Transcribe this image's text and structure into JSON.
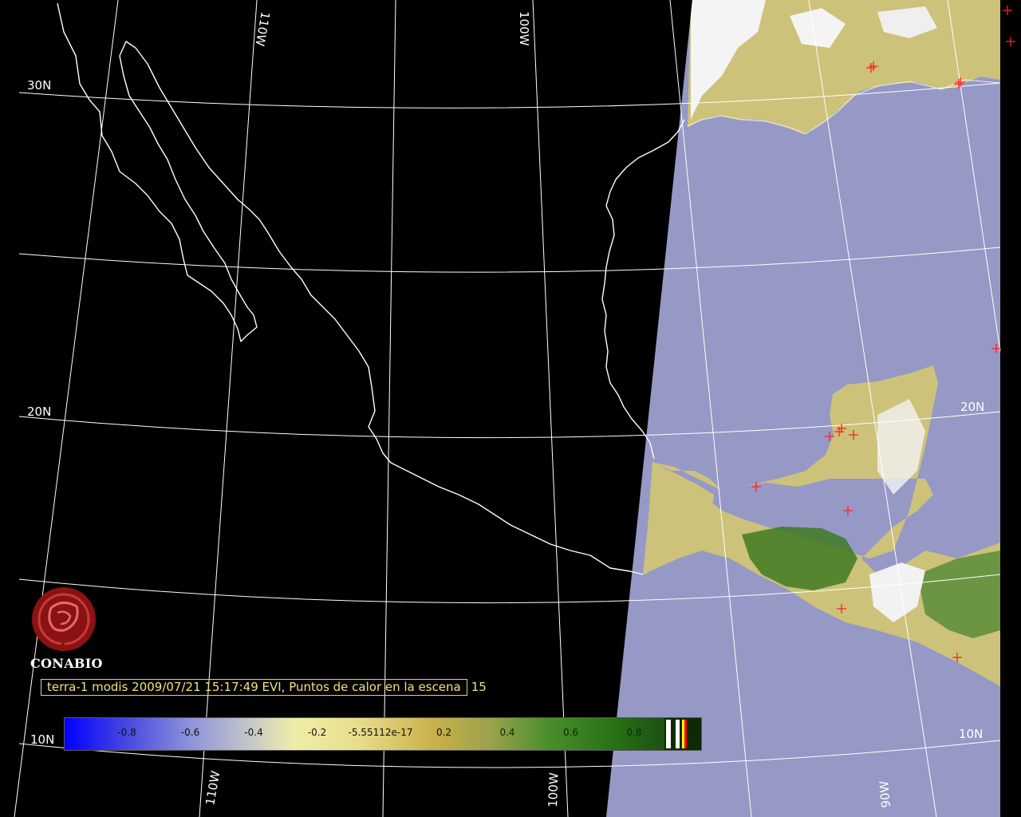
{
  "map": {
    "colors": {
      "background": "#000000",
      "ocean": "#9699c6",
      "land": "#cdc27a",
      "vegetation": "#3f7a22",
      "cloud": "#f4f4f4",
      "grid": "#ffffff",
      "coastline": "#ffffff",
      "hotspot": "#ff2020"
    },
    "grid_labels": {
      "lat_30n_left": "30N",
      "lat_20n_left": "20N",
      "lat_20n_right": "20N",
      "lat_10n_left": "10N",
      "lat_10n_right": "10N",
      "lon_110w_top": "110W",
      "lon_100w_top": "100W",
      "lon_110w_bottom": "110W",
      "lon_100w_bottom": "100W",
      "lon_90w_bottom": "90W"
    },
    "hotspot_count": 15
  },
  "logo": {
    "name": "CONABIO",
    "icon": "conabio-logo-icon"
  },
  "caption": {
    "text": "terra-1 modis 2009/07/21 15:17:49 EVI, Puntos de calor en la escena",
    "count": "15"
  },
  "colorbar": {
    "ticks": [
      "-0.8",
      "-0.6",
      "-0.4",
      "-0.2",
      "-5.55112e-17",
      "0.2",
      "0.4",
      "0.6",
      "0.8"
    ],
    "colors": [
      "#0000ff",
      "#8e95d8",
      "#efeda9",
      "#c9b04a",
      "#4a8e2c",
      "#0d3409"
    ],
    "end_strips": [
      "#ffffff",
      "#ffffff",
      "#ffff00",
      "#ff0000"
    ]
  }
}
